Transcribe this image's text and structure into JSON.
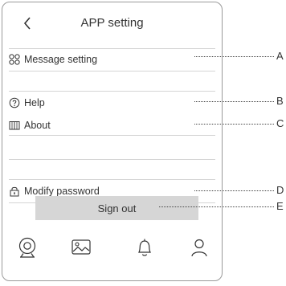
{
  "header": {
    "title": "APP setting"
  },
  "menu": {
    "message_setting": "Message setting",
    "help": "Help",
    "about": "About",
    "modify_password": "Modify password"
  },
  "sign_out_label": "Sign out",
  "callouts": [
    "A",
    "B",
    "C",
    "D",
    "E"
  ],
  "tabbar": [
    "camera-icon",
    "gallery-icon",
    "bell-icon",
    "user-icon"
  ],
  "icons": {
    "back": "chevron-left-icon",
    "message_setting": "grid-icon",
    "help": "help-circle-icon",
    "about": "book-icon",
    "modify_password": "lock-icon"
  }
}
